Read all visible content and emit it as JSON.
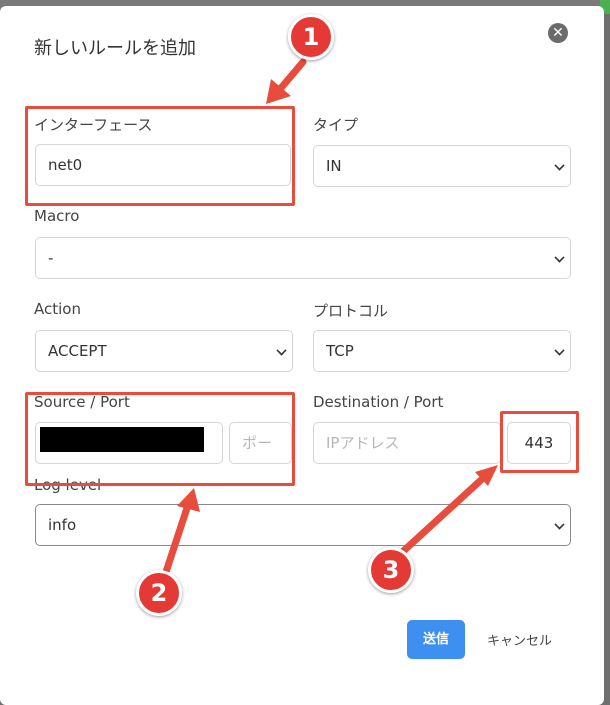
{
  "dialog": {
    "title": "新しいルールを追加",
    "close_label": "✕"
  },
  "form": {
    "interface": {
      "label": "インターフェース",
      "value": "net0"
    },
    "type": {
      "label": "タイプ",
      "value": "IN"
    },
    "macro": {
      "label": "Macro",
      "value": "-"
    },
    "action": {
      "label": "Action",
      "value": "ACCEPT"
    },
    "protocol": {
      "label": "プロトコル",
      "value": "TCP"
    },
    "source": {
      "label": "Source / Port",
      "port_placeholder": "ポー"
    },
    "destination": {
      "label": "Destination / Port",
      "ip_placeholder": "IPアドレス",
      "port_value": "443"
    },
    "log_level": {
      "label": "Log level",
      "value": "info"
    }
  },
  "buttons": {
    "submit": "送信",
    "cancel": "キャンセル"
  },
  "annotations": {
    "badge1": "1",
    "badge2": "2",
    "badge3": "3"
  },
  "colors": {
    "accent": "#3d8ff0",
    "highlight": "#e74c3c",
    "badge": "#e53935"
  }
}
